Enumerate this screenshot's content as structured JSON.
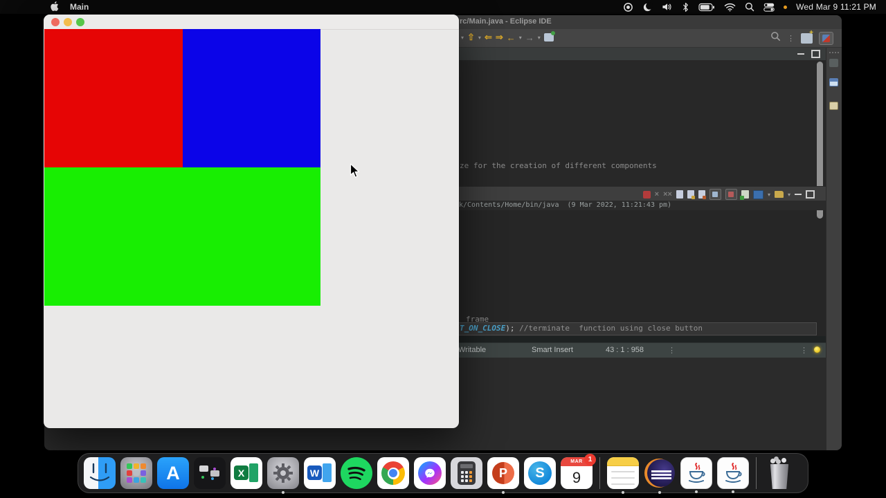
{
  "menu_bar": {
    "app_name": "Main",
    "clock": "Wed Mar 9 11:21 PM",
    "status_icons": [
      "record-indicator",
      "do-not-disturb-moon",
      "volume",
      "bluetooth",
      "battery",
      "wifi",
      "spotlight-search",
      "control-center",
      "recording-dot"
    ]
  },
  "java_window": {
    "panel_colors": {
      "red": "#e60505",
      "blue": "#0b04e8",
      "green": "#18ee02"
    }
  },
  "eclipse": {
    "title": "rc/Main.java - Eclipse IDE",
    "editor": {
      "comment_line": "ze for the creation of different components",
      "frame_line": "frame",
      "code_keyword": "T_ON_CLOSE",
      "code_after": "); ",
      "code_comment": "//terminate  function using close button"
    },
    "console_header": "k/Contents/Home/bin/java  (9 Mar 2022, 11:21:43 pm)",
    "status": {
      "writable": "Writable",
      "insert_mode": "Smart Insert",
      "caret_position": "43 : 1 : 958"
    }
  },
  "dock": {
    "items": [
      "finder",
      "launchpad",
      "app-store",
      "mission-control",
      "excel",
      "system-preferences",
      "word",
      "spotify",
      "chrome",
      "messenger",
      "calculator",
      "powerpoint",
      "skype",
      "calendar",
      "notes",
      "eclipse",
      "java-app-1",
      "java-app-2",
      "trash"
    ],
    "running": [
      "finder",
      "system-preferences",
      "powerpoint",
      "notes",
      "eclipse",
      "java-app-1",
      "java-app-2"
    ],
    "glyphs": {
      "appstore": "A",
      "excel": "X",
      "word": "W",
      "powerpoint": "P",
      "skype": "S"
    },
    "calendar": {
      "month": "MAR",
      "day": "9",
      "badge": "1"
    }
  }
}
